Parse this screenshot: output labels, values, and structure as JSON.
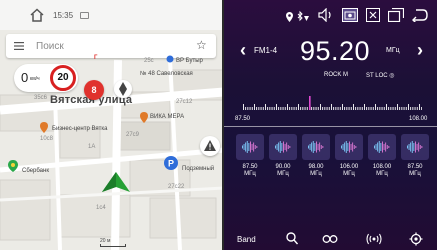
{
  "map": {
    "status": {
      "time": "15:35"
    },
    "search": {
      "placeholder": "Поиск"
    },
    "speed": {
      "value": "0",
      "unit": "км/ч",
      "limit": "20"
    },
    "street": "Вятская улица",
    "poi_badge": "8",
    "labels": {
      "gps": "Г",
      "building_25c": "25с",
      "bp_butyrki": "ВР Бутыр",
      "savelovskaya": "№ 48 Савеловская",
      "n35c6": "35с6",
      "n27c12": "27с12",
      "vika_mera": "ВИКА МЕРА",
      "bc_vyatka": "Бизнес-центр Вятка",
      "n10c8": "10с8",
      "n1a": "1А",
      "n27c9": "27с9",
      "sberbank": "Сбербанк",
      "parking": "Подземный",
      "n27c22": "27с22",
      "n1c4": "1с4",
      "scale": "20 м"
    }
  },
  "radio": {
    "band": "FM1-4",
    "frequency": "95.20",
    "frequency_unit": "МГц",
    "station": "ROCK M",
    "st_loc": "ST LOC",
    "scale_min": "87.50",
    "scale_max": "108.00",
    "presets": [
      {
        "freq": "87.50",
        "unit": "МГц"
      },
      {
        "freq": "90.00",
        "unit": "МГц"
      },
      {
        "freq": "98.00",
        "unit": "МГц"
      },
      {
        "freq": "106.00",
        "unit": "МГц"
      },
      {
        "freq": "108.00",
        "unit": "МГц"
      },
      {
        "freq": "87.50",
        "unit": "МГц"
      }
    ],
    "bottom": {
      "band_label": "Band"
    },
    "icons": [
      "location-icon",
      "bluetooth-icon",
      "volume-icon",
      "screenshot-icon",
      "close-icon",
      "multiwindow-icon",
      "back-icon",
      "search-icon",
      "loop-icon",
      "broadcast-icon",
      "settings-icon"
    ]
  },
  "colors": {
    "accent_pink": "#e04ad0",
    "speed_limit_red": "#d82020",
    "radio_bg": "#1b1036"
  }
}
